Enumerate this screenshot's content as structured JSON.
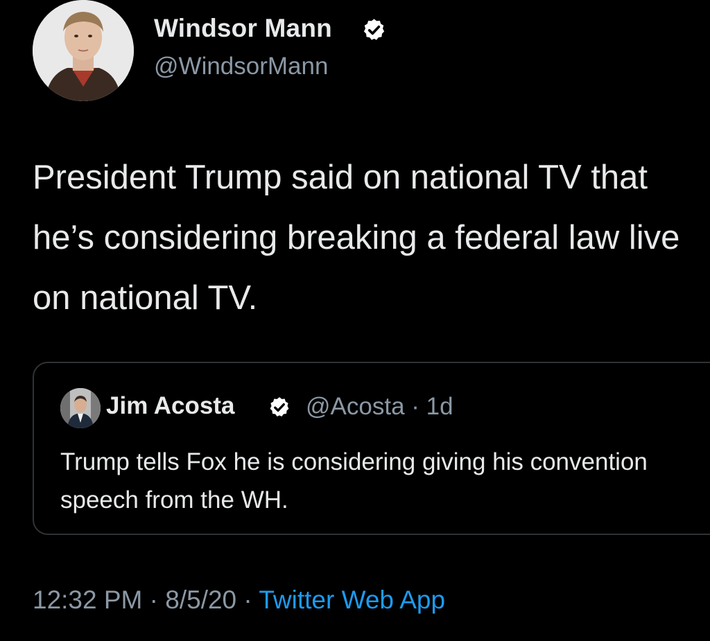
{
  "author": {
    "name": "Windsor Mann",
    "handle": "@WindsorMann",
    "verified_icon": "verified-badge-icon"
  },
  "tweet": {
    "text": "President Trump said on national TV that he’s considering breaking a federal law live on national TV."
  },
  "quoted_tweet": {
    "name": "Jim Acosta",
    "handle": "@Acosta",
    "separator": " · ",
    "age": "1d",
    "text": "Trump tells Fox he is considering giving his convention speech from the WH."
  },
  "footer": {
    "time": "12:32 PM",
    "separator": " · ",
    "date": "8/5/20",
    "source": "Twitter Web App"
  },
  "colors": {
    "background": "#000000",
    "primary_text": "#e7e9ea",
    "secondary_text": "#8b98a5",
    "link": "#1d9bf0",
    "border": "#2f3336"
  }
}
